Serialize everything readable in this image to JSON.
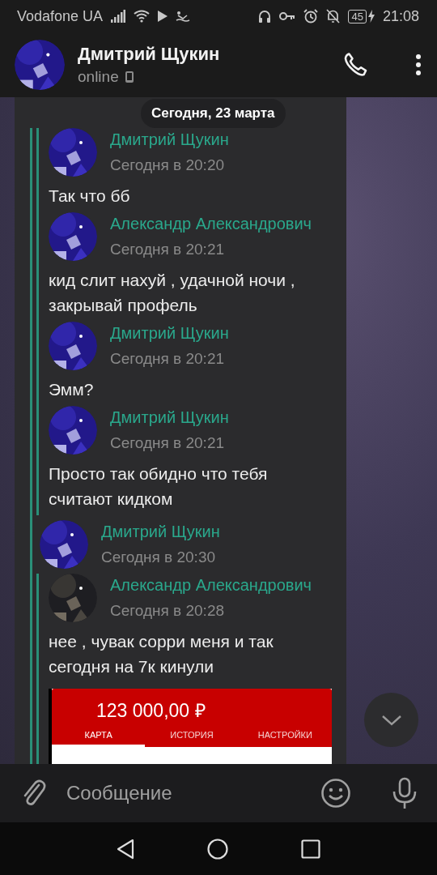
{
  "status_bar": {
    "carrier": "Vodafone UA",
    "battery": "45",
    "time": "21:08"
  },
  "header": {
    "name": "Дмитрий Щукин",
    "status": "online"
  },
  "date_pill": "Сегодня, 23 марта",
  "forward": {
    "quoted": [
      {
        "author": "Дмитрий Щукин",
        "time": "Сегодня в 20:20",
        "text": "Так что бб"
      },
      {
        "author": "Александр Александрович",
        "time": "Сегодня в 20:21",
        "text": "кид слит нахуй , удачной ночи , закрывай профель"
      },
      {
        "author": "Дмитрий Щукин",
        "time": "Сегодня в 20:21",
        "text": "Эмм?"
      },
      {
        "author": "Дмитрий Щукин",
        "time": "Сегодня в 20:21",
        "text": "Просто так обидно что тебя считают кидком"
      }
    ],
    "author": "Дмитрий Щукин",
    "time": "Сегодня в 20:30",
    "quoted_after": [
      {
        "author": "Александр Александрович",
        "time": "Сегодня в 20:28",
        "text": "нее , чувак сорри меня и так сегодня на 7к кинули",
        "attachment": {
          "kind": "screenshot",
          "amount": "123 000,00 ₽",
          "tabs": [
            {
              "label": "КАРТА",
              "selected": true
            },
            {
              "label": "ИСТОРИЯ",
              "selected": false
            },
            {
              "label": "НАСТРОЙКИ",
              "selected": false
            }
          ]
        }
      }
    ]
  },
  "composer": {
    "placeholder": "Сообщение"
  }
}
